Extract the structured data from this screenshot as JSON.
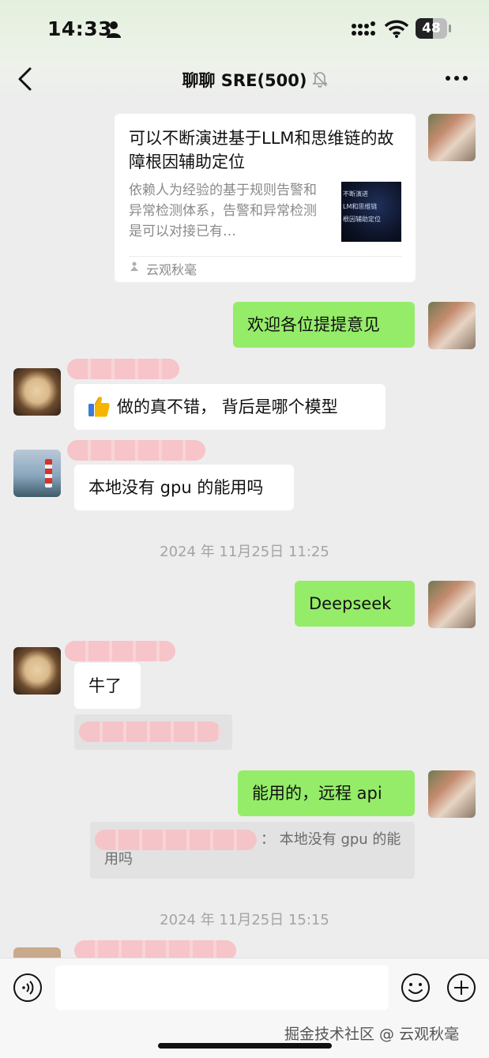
{
  "status_bar": {
    "time": "14:33",
    "battery": "48"
  },
  "header": {
    "title": "聊聊 SRE(500)"
  },
  "messages": {
    "link_card": {
      "title": "可以不断演进基于LLM和思维链的故障根因辅助定位",
      "description": "依赖人为经验的基于规则告警和异常检测体系，告警和异常检测是可以对接已有…",
      "thumb_lines": [
        "不断演进",
        "LM和思维链",
        "根因辅助定位"
      ],
      "source": "云观秋毫"
    },
    "msg_welcome": "欢迎各位提提意见",
    "msg_good": "做的真不错， 背后是哪个模型",
    "msg_gpu": "本地没有 gpu 的能用吗",
    "time1": "2024 年 11月25日 11:25",
    "msg_deepseek": "Deepseek",
    "msg_niu": "牛了",
    "msg_remote": "能用的，远程 api",
    "quote_text": "：  本地没有 gpu 的能用吗",
    "time2": "2024 年 11月25日 15:15"
  },
  "watermark": "掘金技术社区 @ 云观秋毫",
  "colors": {
    "green_bubble": "#95ec69",
    "background": "#ededed"
  }
}
